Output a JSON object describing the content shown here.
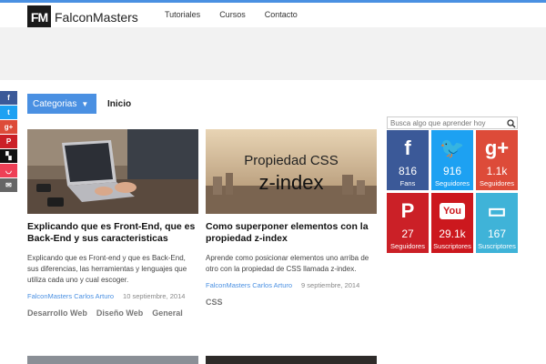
{
  "logo": {
    "mark": "FM",
    "text": "FalconMasters"
  },
  "nav": [
    "Tutoriales",
    "Cursos",
    "Contacto"
  ],
  "categories_button": "Categorias",
  "inicio": "Inicio",
  "social_left": [
    {
      "icon": "facebook-icon",
      "glyph": "f",
      "color": "#3b5998"
    },
    {
      "icon": "twitter-icon",
      "glyph": "t",
      "color": "#1da1f2"
    },
    {
      "icon": "google-plus-icon",
      "glyph": "g+",
      "color": "#dd4b39"
    },
    {
      "icon": "pinterest-icon",
      "glyph": "P",
      "color": "#cb2027"
    },
    {
      "icon": "bookmark-icon",
      "glyph": "▚",
      "color": "#111111"
    },
    {
      "icon": "pocket-icon",
      "glyph": "◡",
      "color": "#ee4056"
    },
    {
      "icon": "email-icon",
      "glyph": "✉",
      "color": "#666666"
    }
  ],
  "posts": [
    {
      "title": "Explicando que es Front-End, que es Back-End y sus caracteristicas",
      "excerpt": "Explicando que es Front-end y que es Back-End, sus diferencias, las herramientas y lenguajes que utiliza cada uno y cual escoger.",
      "author": "FalconMasters Carlos Arturo",
      "date": "10 septiembre, 2014",
      "tags": [
        "Desarrollo Web",
        "Diseño Web",
        "General"
      ]
    },
    {
      "title": "Como superponer elementos con la propiedad z-index",
      "image_line1": "Propiedad CSS",
      "image_line2": "z-index",
      "excerpt": "Aprende como posicionar elementos uno arriba de otro con la propiedad de CSS llamada z-index.",
      "author": "FalconMasters Carlos Arturo",
      "date": "9 septiembre, 2014",
      "tags": [
        "CSS"
      ]
    }
  ],
  "search": {
    "placeholder": "Busca algo que aprender hoy"
  },
  "social_tiles": [
    {
      "icon": "facebook-icon",
      "glyph": "f",
      "count": "816",
      "label": "Fans",
      "color": "#3b5998"
    },
    {
      "icon": "twitter-icon",
      "glyph": "🐦",
      "count": "916",
      "label": "Seguidores",
      "color": "#1da1f2"
    },
    {
      "icon": "google-plus-icon",
      "glyph": "g+",
      "count": "1.1k",
      "label": "Seguidores",
      "color": "#dd4b39"
    },
    {
      "icon": "pinterest-icon",
      "glyph": "P",
      "count": "27",
      "label": "Seguidores",
      "color": "#cb2027"
    },
    {
      "icon": "youtube-icon",
      "glyph": "You",
      "count": "29.1k",
      "label": "Suscriptores",
      "color": "#cc181e"
    },
    {
      "icon": "rss-icon",
      "glyph": "▭",
      "count": "167",
      "label": "Suscriptores",
      "color": "#3fb3d8"
    }
  ]
}
